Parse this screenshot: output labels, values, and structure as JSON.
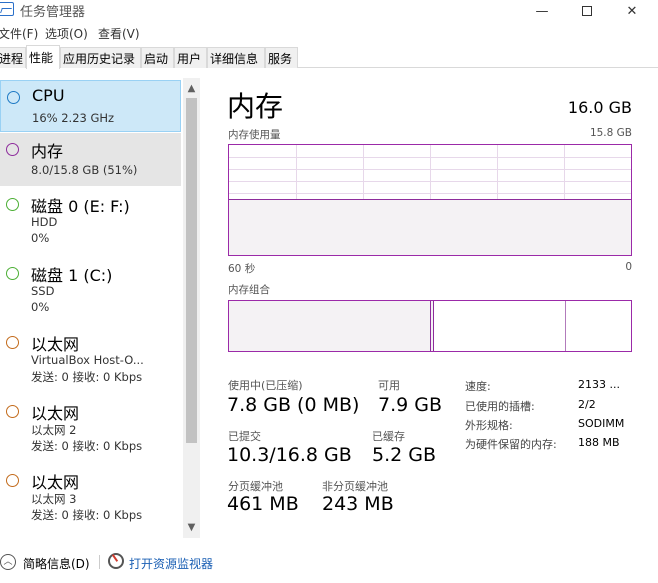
{
  "window": {
    "title": "任务管理器",
    "icon": "task-manager-icon",
    "controls": {
      "minimize": "—",
      "maximize": "□",
      "close": "✕"
    }
  },
  "menu": [
    "文件(F)",
    "选项(O)",
    "查看(V)"
  ],
  "tabs": [
    "进程",
    "性能",
    "应用历史记录",
    "启动",
    "用户",
    "详细信息",
    "服务"
  ],
  "active_tab": "性能",
  "sidebar": {
    "items": [
      {
        "name": "CPU",
        "sub1": "16% 2.23 GHz",
        "sub2": "",
        "color": "#1f7ac4",
        "state": "selected"
      },
      {
        "name": "内存",
        "sub1": "8.0/15.8 GB (51%)",
        "sub2": "",
        "color": "#8e2c9c",
        "state": "hover"
      },
      {
        "name": "磁盘 0 (E: F:)",
        "sub1": "HDD",
        "sub2": "0%",
        "color": "#4caf35"
      },
      {
        "name": "磁盘 1 (C:)",
        "sub1": "SSD",
        "sub2": "0%",
        "color": "#4caf35"
      },
      {
        "name": "以太网",
        "sub1": "VirtualBox Host-O...",
        "sub2": "发送: 0 接收: 0 Kbps",
        "color": "#c36b1c"
      },
      {
        "name": "以太网",
        "sub1": "以太网 2",
        "sub2": "发送: 0 接收: 0 Kbps",
        "color": "#c36b1c"
      },
      {
        "name": "以太网",
        "sub1": "以太网 3",
        "sub2": "发送: 0 接收: 0 Kbps",
        "color": "#c36b1c"
      }
    ]
  },
  "memory": {
    "title": "内存",
    "total": "16.0 GB",
    "usage_label": "内存使用量",
    "usage_max": "15.8 GB",
    "usage_level": 0.51,
    "time_left": "60 秒",
    "time_right": "0",
    "composition_label": "内存组合",
    "stats": {
      "in_use_label": "使用中(已压缩)",
      "in_use_value": "7.8 GB (0 MB)",
      "available_label": "可用",
      "available_value": "7.9 GB",
      "committed_label": "已提交",
      "committed_value": "10.3/16.8 GB",
      "cached_label": "已缓存",
      "cached_value": "5.2 GB",
      "paged_label": "分页缓冲池",
      "paged_value": "461 MB",
      "nonpaged_label": "非分页缓冲池",
      "nonpaged_value": "243 MB"
    },
    "specs": {
      "speed_label": "速度:",
      "speed_value": "2133 ...",
      "slots_label": "已使用的插槽:",
      "slots_value": "2/2",
      "form_label": "外形规格:",
      "form_value": "SODIMM",
      "reserved_label": "为硬件保留的内存:",
      "reserved_value": "188 MB"
    }
  },
  "footer": {
    "summary": "简略信息(D)",
    "resource_monitor": "打开资源监视器"
  }
}
